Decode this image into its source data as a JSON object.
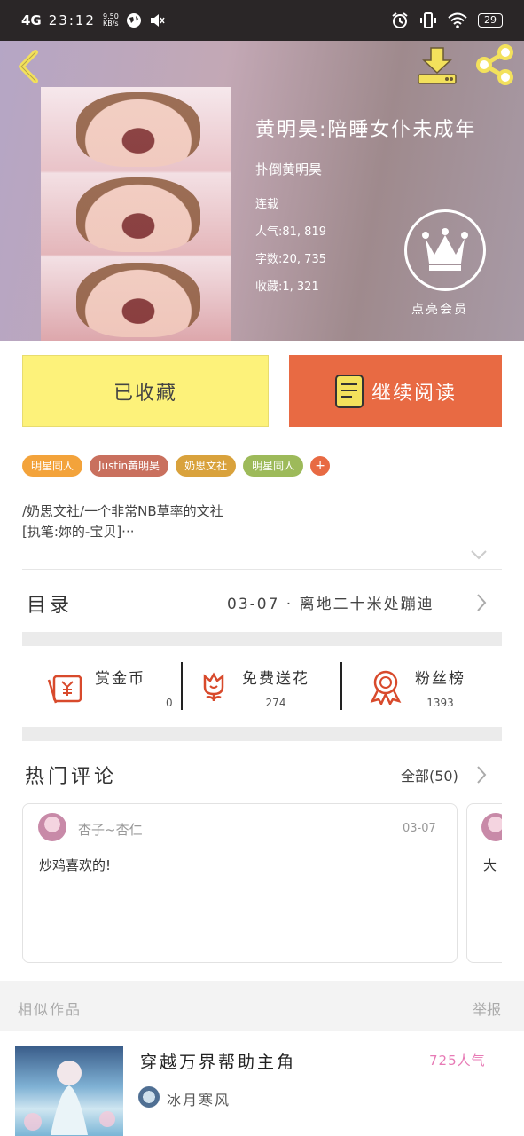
{
  "status_bar": {
    "network": "4G",
    "time": "23:12",
    "net_speed_value": "9.50",
    "net_speed_unit": "KB/s",
    "battery": "29"
  },
  "book": {
    "title": "黄明昊:陪睡女仆未成年",
    "author": "扑倒黄明昊",
    "status": "连载",
    "popularity": "人气:81, 819",
    "word_count": "字数:20, 735",
    "favorites": "收藏:1, 321",
    "member_label": "点亮会员"
  },
  "actions": {
    "collected_label": "已收藏",
    "read_label": "继续阅读"
  },
  "tags": [
    {
      "label": "明星同人",
      "color": "#f3a33b"
    },
    {
      "label": "Justin黄明昊",
      "color": "#c9705e"
    },
    {
      "label": "奶思文社",
      "color": "#d9a23c"
    },
    {
      "label": "明星同人",
      "color": "#9dba5a"
    }
  ],
  "tag_more": "+",
  "description": {
    "line1": "/奶思文社/一个非常NB草率的文社",
    "line2": "[执笔:妳的-宝贝]···"
  },
  "toc": {
    "label": "目录",
    "latest": "03-07 · 离地二十米处蹦迪"
  },
  "stats": [
    {
      "name": "赏金币",
      "value": "0",
      "icon": "red-envelope-icon"
    },
    {
      "name": "免费送花",
      "value": "274",
      "icon": "flower-icon"
    },
    {
      "name": "粉丝榜",
      "value": "1393",
      "icon": "medal-icon"
    }
  ],
  "comments": {
    "title": "热门评论",
    "all_label": "全部(50)",
    "items": [
      {
        "user": "杏子~杏仁",
        "date": "03-07",
        "text": "炒鸡喜欢的!"
      },
      {
        "user": "",
        "date": "",
        "text": "大"
      }
    ]
  },
  "similar": {
    "label": "相似作品",
    "report": "举报",
    "item": {
      "title": "穿越万界帮助主角",
      "popularity": "725人气",
      "author": "冰月寒风"
    }
  },
  "colors": {
    "accent_orange": "#e86a43",
    "collected_yellow": "#fdf27a",
    "icon_red": "#d84a2c"
  }
}
